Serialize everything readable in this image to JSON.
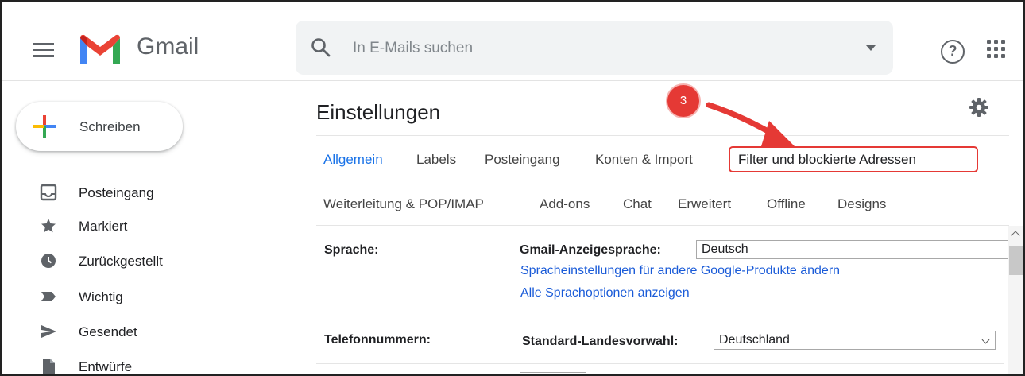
{
  "header": {
    "app_name": "Gmail",
    "search_placeholder": "In E-Mails suchen",
    "help_glyph": "?"
  },
  "sidebar": {
    "compose_label": "Schreiben",
    "items": [
      {
        "label": "Posteingang",
        "icon": "inbox-icon"
      },
      {
        "label": "Markiert",
        "icon": "star-icon"
      },
      {
        "label": "Zurückgestellt",
        "icon": "clock-icon"
      },
      {
        "label": "Wichtig",
        "icon": "important-icon"
      },
      {
        "label": "Gesendet",
        "icon": "send-icon"
      },
      {
        "label": "Entwürfe",
        "icon": "draft-icon"
      }
    ]
  },
  "main": {
    "title": "Einstellungen",
    "tabs_row1": [
      "Allgemein",
      "Labels",
      "Posteingang",
      "Konten & Import",
      "Filter und blockierte Adressen"
    ],
    "tabs_row2": [
      "Weiterleitung & POP/IMAP",
      "Add-ons",
      "Chat",
      "Erweitert",
      "Offline",
      "Designs"
    ],
    "active_tab": "Allgemein",
    "annotation_number": "3",
    "settings": {
      "language": {
        "label": "Sprache:",
        "field_label": "Gmail-Anzeigesprache:",
        "value": "Deutsch",
        "link1": "Spracheinstellungen für andere Google-Produkte ändern",
        "link2": "Alle Sprachoptionen anzeigen"
      },
      "phone": {
        "label": "Telefonnummern:",
        "field_label": "Standard-Landesvorwahl:",
        "value": "Deutschland"
      }
    }
  },
  "colors": {
    "accent": "#1a73e8",
    "annotation": "#e53935",
    "link": "#1a5bd8"
  }
}
